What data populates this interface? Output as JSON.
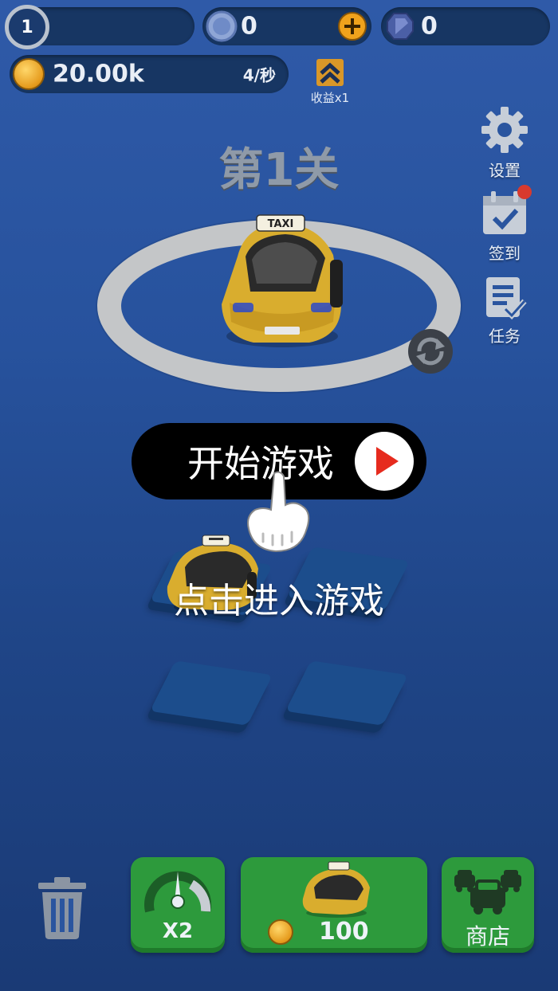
{
  "top_bar": {
    "level": "1",
    "silver_count": "0",
    "gem_count": "0",
    "gold_amount": "20.00k",
    "income_rate": "4/秒",
    "income_multiplier_label": "收益x1"
  },
  "stage_title": "第1关",
  "side_menu": {
    "settings_label": "设置",
    "checkin_label": "签到",
    "tasks_label": "任务"
  },
  "car": {
    "roof_sign": "TAXI"
  },
  "start_button_label": "开始游戏",
  "tutorial_hint": "点击进入游戏",
  "bottom_bar": {
    "speed_label": "X2",
    "buy_price": "100",
    "shop_label": "商店"
  },
  "colors": {
    "background": "#2a559f",
    "pill_dark": "#173663",
    "green_button": "#2d9a3c",
    "taxi_yellow": "#e0b632",
    "play_red": "#e62b1e"
  },
  "icons": [
    "silver-coin-icon",
    "plus-icon",
    "gem-icon",
    "gold-coin-icon",
    "double-arrow-up-icon",
    "gear-icon",
    "calendar-check-icon",
    "notification-dot-icon",
    "task-list-icon",
    "rotate-icon",
    "play-icon",
    "pointing-hand-icon",
    "trash-icon",
    "speedometer-icon",
    "cars-icon"
  ]
}
